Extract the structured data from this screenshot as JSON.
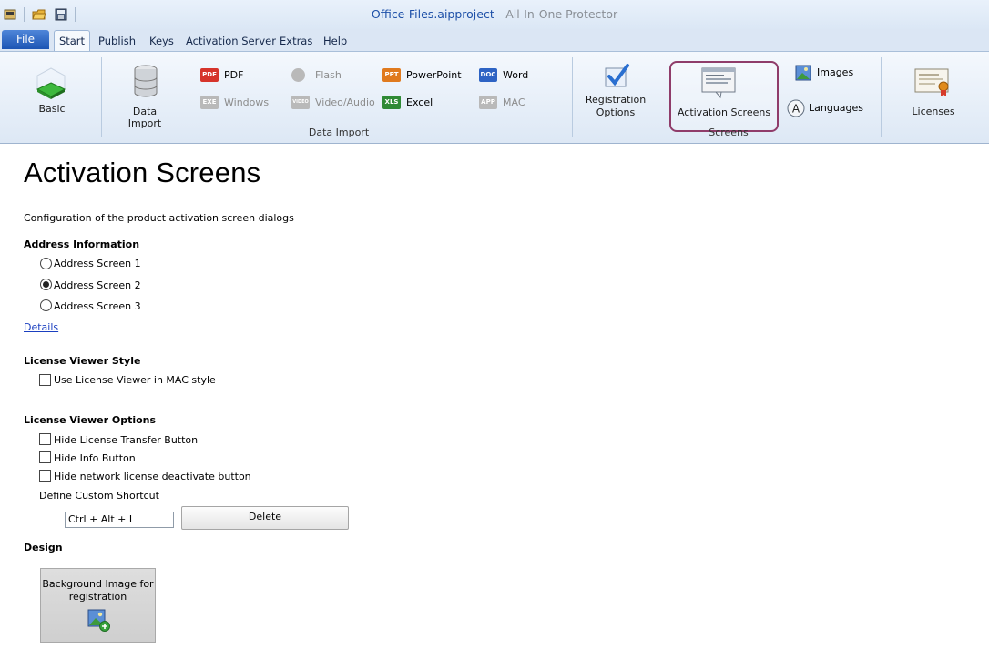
{
  "window": {
    "document_name": "Office-Files.aipproject",
    "app_name": "All-In-One Protector",
    "separator": " - "
  },
  "tabs": {
    "file": "File",
    "items": [
      "Start",
      "Publish",
      "Keys",
      "Activation Server",
      "Extras",
      "Help"
    ],
    "active": "Start"
  },
  "ribbon": {
    "basic": "Basic",
    "data_import": "Data Import",
    "pdf": "PDF",
    "windows": "Windows",
    "flash": "Flash",
    "video_audio": "Video/Audio",
    "powerpoint": "PowerPoint",
    "excel": "Excel",
    "word": "Word",
    "mac": "MAC",
    "group_data_import": "Data Import",
    "registration_options_line1": "Registration",
    "registration_options_line2": "Options",
    "activation_screens": "Activation Screens",
    "images": "Images",
    "languages": "Languages",
    "group_screens": "Screens",
    "licenses": "Licenses",
    "icon_text": {
      "pdf": "PDF",
      "exe": "EXE",
      "video": "VIDEO",
      "ppt": "PPT",
      "xls": "XLS",
      "doc": "DOC",
      "app": "APP"
    }
  },
  "content": {
    "title": "Activation Screens",
    "description": "Configuration of the product activation screen dialogs",
    "address_section": "Address Information",
    "address_options": [
      "Address Screen 1",
      "Address Screen 2",
      "Address Screen 3"
    ],
    "address_selected": "Address Screen 2",
    "details_link": "Details",
    "viewer_style_section": "License Viewer Style",
    "mac_style_label": "Use License Viewer in MAC style",
    "viewer_options_section": "License Viewer Options",
    "hide_transfer_label": "Hide License Transfer Button",
    "hide_info_label": "Hide Info Button",
    "hide_network_label": "Hide network license deactivate button",
    "shortcut_label": "Define Custom Shortcut",
    "shortcut_value": "Ctrl + Alt + L",
    "delete_label": "Delete",
    "design_section": "Design",
    "background_button_line1": "Background Image for",
    "background_button_line2": "registration"
  },
  "colors": {
    "file_tab": "#1c55b4",
    "highlight_border": "#8f3c6a",
    "link": "#1a3fc0",
    "title_doc": "#1e50a8"
  }
}
